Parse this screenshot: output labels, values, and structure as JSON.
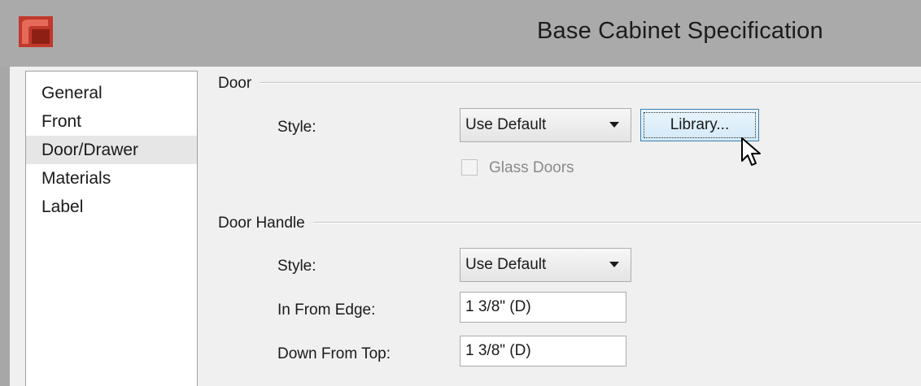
{
  "window": {
    "title": "Base Cabinet Specification",
    "logo_icon": "app-logo-icon",
    "logo_color": "#c0392b"
  },
  "nav": {
    "items": [
      {
        "label": "General",
        "selected": false
      },
      {
        "label": "Front",
        "selected": false
      },
      {
        "label": "Door/Drawer",
        "selected": true
      },
      {
        "label": "Materials",
        "selected": false
      },
      {
        "label": "Label",
        "selected": false
      }
    ]
  },
  "door": {
    "group_title": "Door",
    "style_label": "Style:",
    "style_value": "Use Default",
    "library_button": "Library...",
    "glass_doors_label": "Glass Doors",
    "glass_doors_checked": false,
    "glass_doors_enabled": false
  },
  "door_handle": {
    "group_title": "Door Handle",
    "style_label": "Style:",
    "style_value": "Use Default",
    "in_from_edge_label": "In From Edge:",
    "in_from_edge_value": "1 3/8\" (D)",
    "down_from_top_label": "Down From Top:",
    "down_from_top_value": "1 3/8\" (D)"
  },
  "icons": {
    "dropdown": "chevron-down-icon",
    "cursor": "mouse-pointer-icon"
  }
}
